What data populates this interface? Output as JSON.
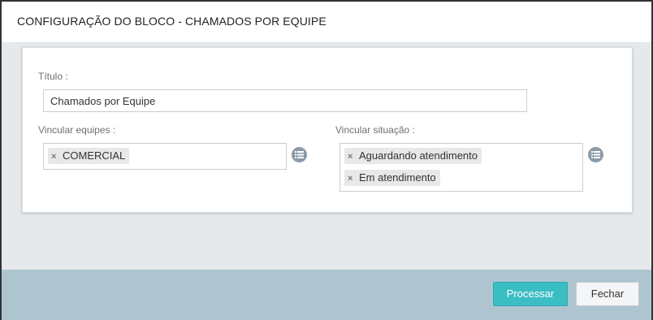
{
  "dialog": {
    "title": "CONFIGURAÇÃO DO BLOCO - CHAMADOS POR EQUIPE"
  },
  "form": {
    "title_label": "Título :",
    "title_value": "Chamados por Equipe",
    "teams_label": "Vincular equipes :",
    "teams_chips": [
      "COMERCIAL"
    ],
    "status_label": "Vincular situação :",
    "status_chips": [
      "Aguardando atendimento",
      "Em atendimento"
    ],
    "list_icon": "list-icon",
    "remove_icon": "×"
  },
  "footer": {
    "process_label": "Processar",
    "close_label": "Fechar"
  },
  "colors": {
    "primary": "#3bbdc4",
    "footer_bg": "#aec5d0",
    "body_bg": "#e5e9ec"
  }
}
